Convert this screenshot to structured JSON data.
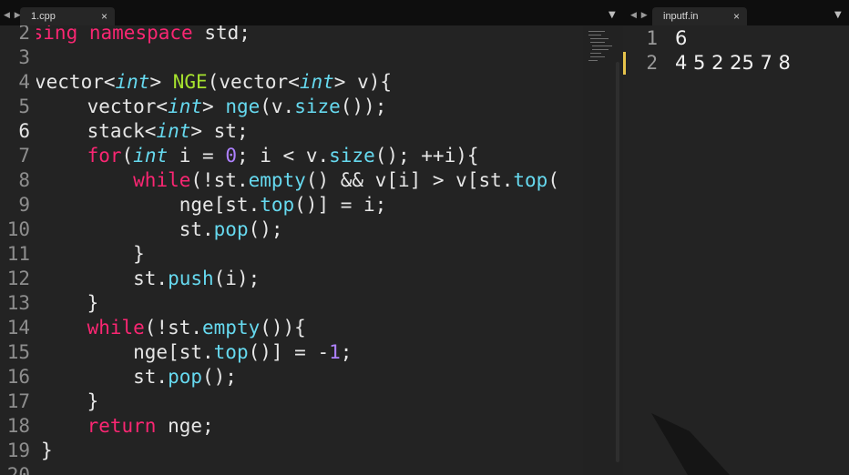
{
  "tabs": {
    "left": {
      "label": "1.cpp",
      "close": "×"
    },
    "right": {
      "label": "inputf.in",
      "close": "×"
    },
    "dropdown": "▼",
    "nav_arrows": "◀ ▶"
  },
  "editor": {
    "line_numbers": [
      "2",
      "3",
      "4",
      "5",
      "6",
      "7",
      "8",
      "9",
      "10",
      "11",
      "12",
      "13",
      "14",
      "15",
      "16",
      "17",
      "18",
      "19",
      "20"
    ],
    "current_line": "6"
  },
  "input_file": {
    "line_numbers": [
      "1",
      "2"
    ],
    "lines": [
      "6",
      "4 5 2 25 7 8"
    ]
  },
  "colors": {
    "background": "#232323",
    "keyword": "#f92672",
    "type": "#66d9ef",
    "function": "#a6e22e",
    "number": "#ae81ff",
    "text": "#e6e6e6",
    "cursor_line_marker": "#e6c34b"
  }
}
